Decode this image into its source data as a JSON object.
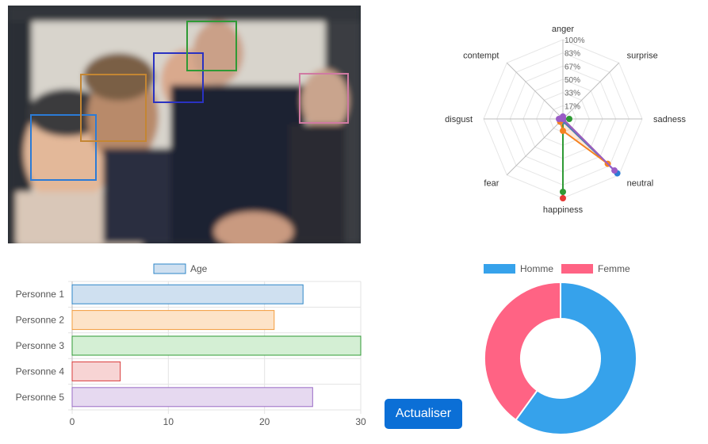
{
  "photo": {
    "faces": [
      {
        "color": "#2b7bd6"
      },
      {
        "color": "#c48633"
      },
      {
        "color": "#2a32c2"
      },
      {
        "color": "#2f9a35"
      },
      {
        "color": "#d07aa3"
      }
    ]
  },
  "button": {
    "label": "Actualiser"
  },
  "chart_data": [
    {
      "type": "radar",
      "axes": [
        "anger",
        "surprise",
        "sadness",
        "neutral",
        "happiness",
        "fear",
        "disgust",
        "contempt"
      ],
      "tick_labels": [
        "17%",
        "33%",
        "50%",
        "67%",
        "83%",
        "100%"
      ],
      "ylim": [
        0,
        100
      ],
      "grid": true,
      "series": [
        {
          "color": "#e53935",
          "values": [
            0,
            0,
            0,
            0,
            100,
            0,
            0,
            0
          ]
        },
        {
          "color": "#2f9a35",
          "values": [
            0,
            0,
            8,
            0,
            92,
            0,
            0,
            0
          ]
        },
        {
          "color": "#2b7bd6",
          "values": [
            0,
            0,
            0,
            97,
            3,
            0,
            0,
            0
          ]
        },
        {
          "color": "#f58220",
          "values": [
            0,
            0,
            0,
            80,
            15,
            5,
            0,
            0
          ]
        },
        {
          "color": "#9a5cc6",
          "values": [
            3,
            0,
            0,
            92,
            0,
            0,
            5,
            0
          ]
        }
      ]
    },
    {
      "type": "bar",
      "orientation": "horizontal",
      "legend": [
        "Age"
      ],
      "legend_position": "top",
      "categories": [
        "Personne 1",
        "Personne 2",
        "Personne 3",
        "Personne 4",
        "Personne 5"
      ],
      "values": [
        24,
        21,
        30,
        5,
        25
      ],
      "xlim": [
        0,
        30
      ],
      "xticks": [
        0,
        10,
        20,
        30
      ],
      "grid": true,
      "colors": [
        {
          "fill": "#cfe0f0",
          "stroke": "#2e86c8"
        },
        {
          "fill": "#fde3c8",
          "stroke": "#f39c3c"
        },
        {
          "fill": "#d4efd4",
          "stroke": "#2f9a35"
        },
        {
          "fill": "#f7d4d4",
          "stroke": "#d93b3b"
        },
        {
          "fill": "#e6d9f0",
          "stroke": "#9a6cc6"
        }
      ]
    },
    {
      "type": "pie",
      "style": "doughnut",
      "legend_position": "top",
      "labels": [
        "Homme",
        "Femme"
      ],
      "values": [
        3,
        2
      ],
      "colors": [
        "#36a2eb",
        "#ff6384"
      ]
    }
  ]
}
